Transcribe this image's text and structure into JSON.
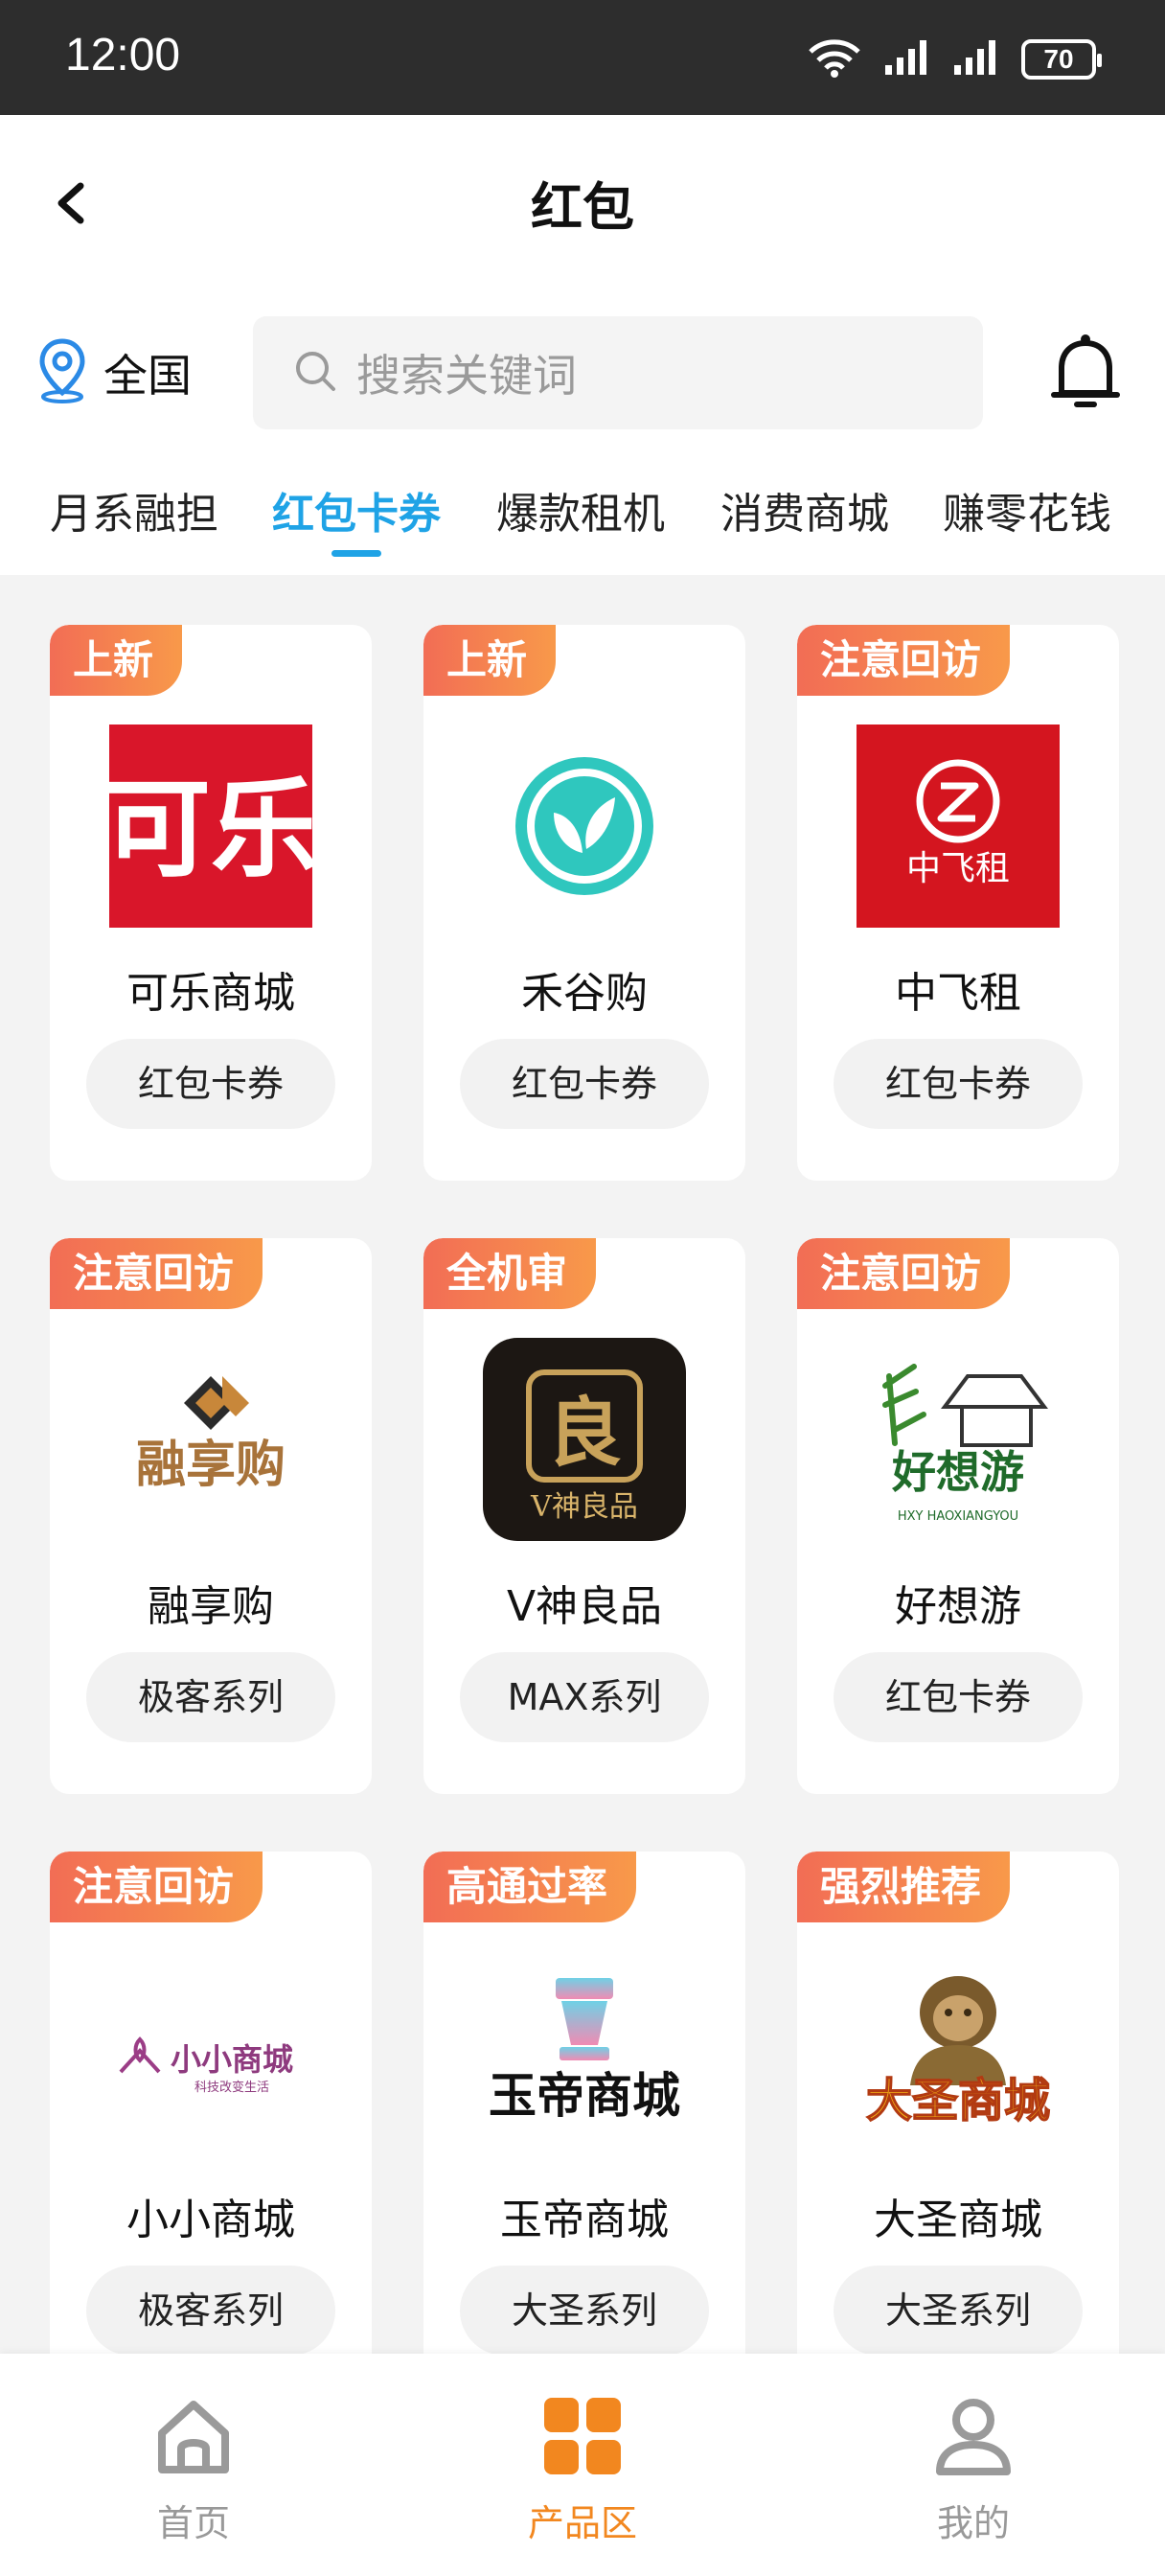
{
  "status_bar": {
    "time": "12:00",
    "battery": "70"
  },
  "header": {
    "title": "红包"
  },
  "location": {
    "label": "全国"
  },
  "search": {
    "placeholder": "搜索关键词"
  },
  "tabs": [
    {
      "label": "月系融担",
      "active": false
    },
    {
      "label": "红包卡券",
      "active": true
    },
    {
      "label": "爆款租机",
      "active": false
    },
    {
      "label": "消费商城",
      "active": false
    },
    {
      "label": "赚零花钱",
      "active": false
    }
  ],
  "products": [
    {
      "badge": "上新",
      "name": "可乐商城",
      "tag": "红包卡券",
      "logo_text": "可乐",
      "logo": "kele-logo"
    },
    {
      "badge": "上新",
      "name": "禾谷购",
      "tag": "红包卡券",
      "logo": "leaf-logo"
    },
    {
      "badge": "注意回访",
      "name": "中飞租",
      "tag": "红包卡券",
      "logo_text": "中飞租",
      "logo": "zhongfeizu-logo"
    },
    {
      "badge": "注意回访",
      "name": "融享购",
      "tag": "极客系列",
      "logo_text": "融享购",
      "logo": "rongxianggou-logo"
    },
    {
      "badge": "全机审",
      "name": "V神良品",
      "tag": "MAX系列",
      "logo_text": "V神良品",
      "logo_mark": "良",
      "logo": "vshen-logo"
    },
    {
      "badge": "注意回访",
      "name": "好想游",
      "tag": "红包卡券",
      "logo_text": "好想游",
      "logo_sub": "HXY HAOXIANGYOU",
      "logo": "haoxiangyou-logo"
    },
    {
      "badge": "注意回访",
      "name": "小小商城",
      "tag": "极客系列",
      "logo_text": "小小商城",
      "logo_sub": "科技改变生活",
      "logo": "xiaoxiao-logo"
    },
    {
      "badge": "高通过率",
      "name": "玉帝商城",
      "tag": "大圣系列",
      "logo_text": "玉帝商城",
      "logo": "yudi-logo"
    },
    {
      "badge": "强烈推荐",
      "name": "大圣商城",
      "tag": "大圣系列",
      "logo_text": "大圣商城",
      "logo": "dasheng-logo"
    }
  ],
  "bottom_nav": [
    {
      "label": "首页",
      "icon": "home-icon",
      "active": false
    },
    {
      "label": "产品区",
      "icon": "grid-icon",
      "active": true
    },
    {
      "label": "我的",
      "icon": "user-icon",
      "active": false
    }
  ],
  "colors": {
    "accent_blue": "#1fa3e6",
    "badge_orange": "#f4794f",
    "nav_active": "#f2871f"
  }
}
